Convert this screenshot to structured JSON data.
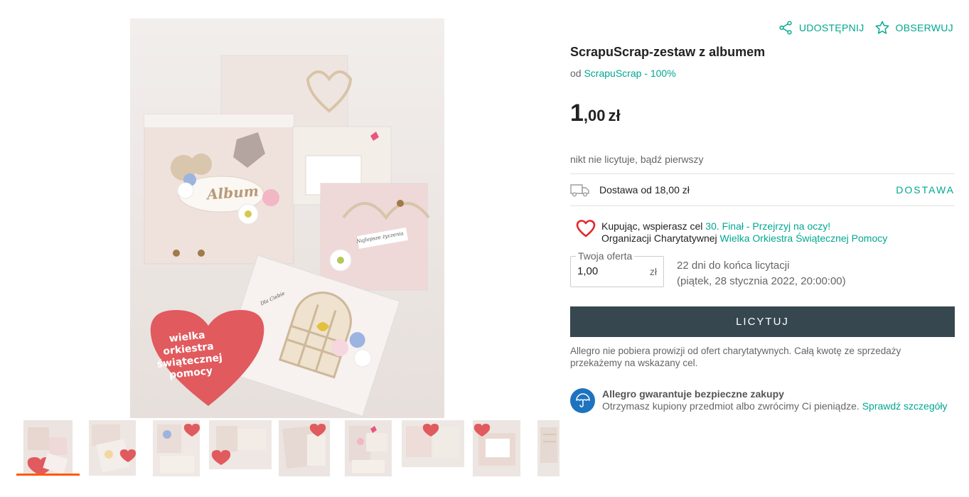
{
  "actions": {
    "share_label": "UDOSTĘPNIJ",
    "watch_label": "OBSERWUJ"
  },
  "product": {
    "title": "ScrapuScrap-zestaw z albumem",
    "seller_prefix": "od",
    "seller_link": "ScrapuScrap - 100%",
    "price_main": "1",
    "price_decimal": ",00",
    "price_currency": "zł",
    "bids_status": "nikt nie licytuje, bądź pierwszy"
  },
  "delivery": {
    "text": "Dostawa od 18,00 zł",
    "link": "DOSTAWA"
  },
  "charity": {
    "line1_prefix": "Kupując, wspierasz cel",
    "goal_link": "30. Finał - Przejrzyj na oczy!",
    "line2_prefix": "Organizacji Charytatywnej",
    "org_link": "Wielka Orkiestra Świątecznej Pomocy"
  },
  "offer": {
    "legend": "Twoja oferta",
    "value": "1,00",
    "currency": "zł",
    "time_left": "22 dni do końca licytacji",
    "end_date": "(piątek, 28 stycznia 2022, 20:00:00)",
    "button_label": "LICYTUJ"
  },
  "notes": {
    "no_commission": "Allegro nie pobiera prowizji od ofert charytatywnych. Całą kwotę ze sprzedaży przekażemy na wskazany cel."
  },
  "guarantee": {
    "heading": "Allegro gwarantuje bezpieczne zakupy",
    "text": "Otrzymasz kupiony przedmiot albo zwrócimy Ci pieniądze.",
    "link": "Sprawdź szczegóły"
  },
  "image": {
    "album_word": "Album",
    "wosp_text": [
      "wielka orkiestra",
      "świątecznej",
      "pomocy"
    ],
    "tag_1": "Najlepsze życzenia",
    "tag_2": "Dla Ciebie"
  },
  "thumbnails": {
    "count": 9,
    "active_index": 0
  },
  "colors": {
    "accent": "#00a790",
    "button": "#37474f",
    "active_thumb": "#ff5a00",
    "charity_heart": "#e4252b",
    "guarantee_icon": "#1e73be"
  }
}
